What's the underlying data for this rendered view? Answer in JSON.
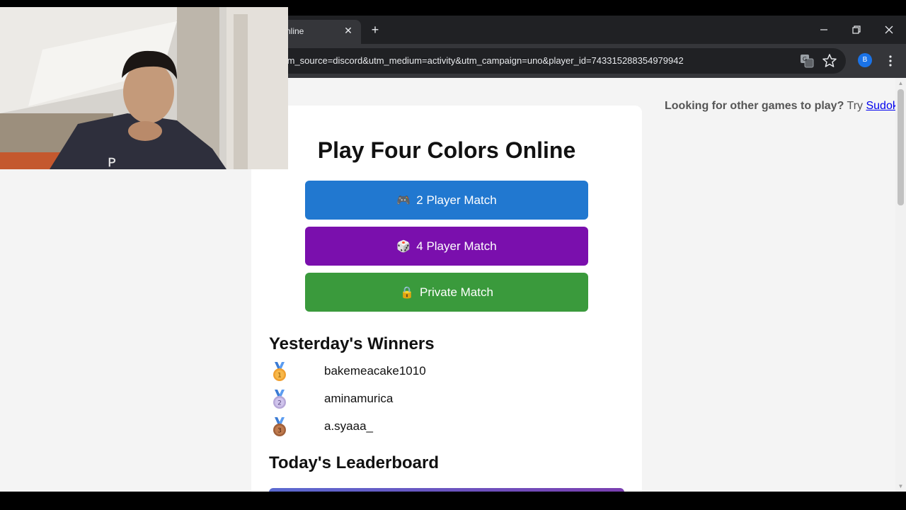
{
  "browser": {
    "tab_title": "nline",
    "tab_close": "✕",
    "new_tab": "+",
    "url": "tm_source=discord&utm_medium=activity&utm_campaign=uno&player_id=743315288354979942",
    "profile_initial": "B"
  },
  "promo": {
    "question": "Looking for other games to play?",
    "try": "Try",
    "link": "Sudoku",
    "end": "!"
  },
  "main": {
    "title": "Play Four Colors Online",
    "buttons": [
      {
        "emoji": "🎮",
        "label": "2 Player Match",
        "color": "#2178d0"
      },
      {
        "emoji": "🎲",
        "label": "4 Player Match",
        "color": "#7a0fad"
      },
      {
        "emoji": "🔒",
        "label": "Private Match",
        "color": "#3a9a3c"
      }
    ]
  },
  "winners": {
    "title": "Yesterday's Winners",
    "list": [
      {
        "rank": "1",
        "medal": "gold-medal-icon",
        "name": "bakemeacake1010"
      },
      {
        "rank": "2",
        "medal": "silver-medal-icon",
        "name": "aminamurica"
      },
      {
        "rank": "3",
        "medal": "bronze-medal-icon",
        "name": "a.syaaa_"
      }
    ]
  },
  "leaderboard": {
    "title": "Today's Leaderboard"
  }
}
